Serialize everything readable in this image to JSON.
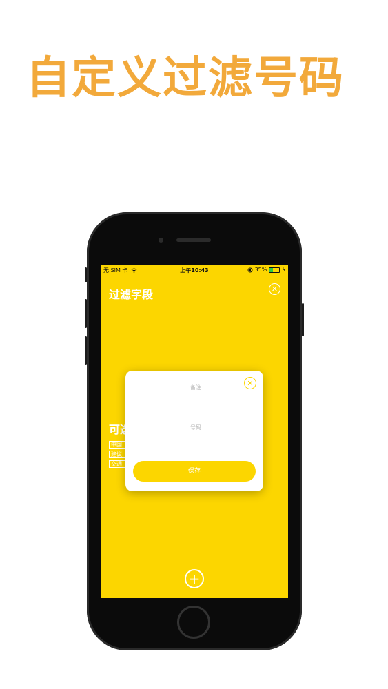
{
  "headline": "自定义过滤号码",
  "status_bar": {
    "carrier": "无 SIM 卡",
    "time": "上午10:43",
    "battery_percent": "35%",
    "battery_level": 0.35
  },
  "screen": {
    "title": "过滤字段",
    "section_title": "可选",
    "chips": [
      "中国",
      "建议",
      "交通"
    ]
  },
  "modal": {
    "note_placeholder": "备注",
    "number_placeholder": "号码",
    "save_label": "保存"
  },
  "icons": {
    "close": "close-icon",
    "add": "plus-icon",
    "wifi": "wifi-icon",
    "battery": "battery-icon"
  },
  "colors": {
    "headline": "#F2A93B",
    "screen_background": "#FCD600",
    "modal_background": "#FFFFFF"
  }
}
